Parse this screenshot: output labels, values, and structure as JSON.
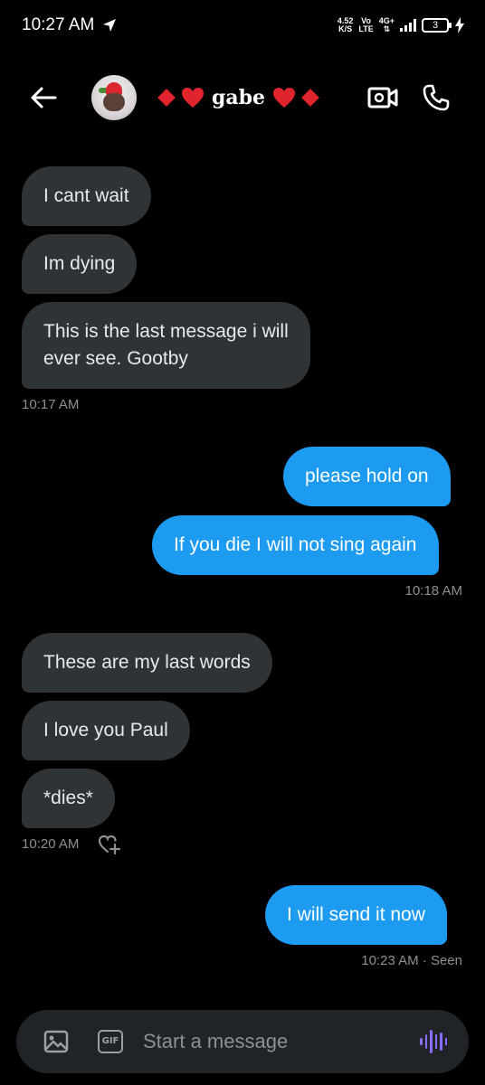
{
  "status_bar": {
    "time": "10:27 AM",
    "net_speed_value": "4.52",
    "net_speed_unit": "K/S",
    "volte_top": "Vo",
    "volte_bottom": "LTE",
    "network": "4G+",
    "battery": "3"
  },
  "header": {
    "contact_name": "gabe"
  },
  "messages": [
    {
      "direction": "in",
      "text": "I cant wait"
    },
    {
      "direction": "in",
      "text": "Im dying"
    },
    {
      "direction": "in",
      "text_line1": "This is the last message i will",
      "text_line2": "ever see. Gootby"
    },
    {
      "direction": "in",
      "timestamp": "10:17 AM"
    },
    {
      "direction": "out",
      "text": "please hold on"
    },
    {
      "direction": "out",
      "text": "If you die I will not sing again"
    },
    {
      "direction": "out",
      "timestamp": "10:18 AM"
    },
    {
      "direction": "in",
      "text": "These are my last words"
    },
    {
      "direction": "in",
      "text": "I love you Paul"
    },
    {
      "direction": "in",
      "text": "*dies*"
    },
    {
      "direction": "in",
      "timestamp": "10:20 AM"
    },
    {
      "direction": "out",
      "text": "I will send it now"
    },
    {
      "direction": "out",
      "timestamp": "10:23 AM · Seen"
    }
  ],
  "composer": {
    "placeholder": "Start a message",
    "gif_label": "GIF"
  },
  "colors": {
    "background": "#000000",
    "incoming_bubble": "#2f3336",
    "outgoing_bubble": "#1d9bf0",
    "accent_red": "#e0242d",
    "voice_accent": "#8b6cf5"
  }
}
